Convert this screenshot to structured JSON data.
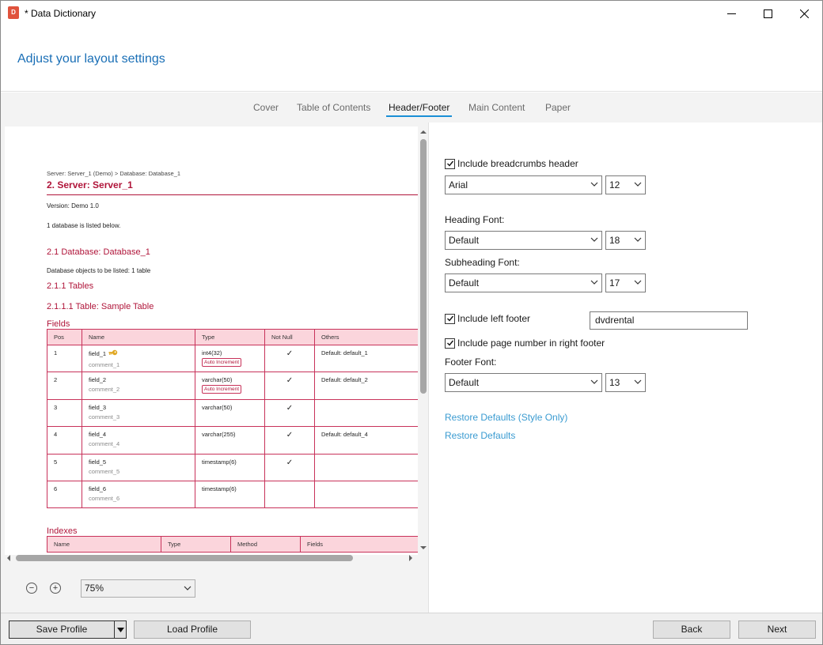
{
  "window": {
    "title": "* Data Dictionary",
    "icon_label": "D"
  },
  "header": {
    "title": "Adjust your layout settings"
  },
  "tabs": [
    {
      "label": "Cover",
      "active": false
    },
    {
      "label": "Table of Contents",
      "active": false
    },
    {
      "label": "Header/Footer",
      "active": true
    },
    {
      "label": "Main Content",
      "active": false
    },
    {
      "label": "Paper",
      "active": false
    }
  ],
  "preview": {
    "breadcrumb": "Server: Server_1 (Demo)  >  Database: Database_1",
    "server_title": "2. Server: Server_1",
    "version": "Version: Demo 1.0",
    "db_listed": "1 database is listed below.",
    "db_title": "2.1 Database: Database_1",
    "db_objects": "Database objects to be listed: 1 table",
    "tables_title": "2.1.1 Tables",
    "table_title": "2.1.1.1 Table: Sample Table",
    "fields_title": "Fields",
    "fields_headers": [
      "Pos",
      "Name",
      "Type",
      "Not Null",
      "Others"
    ],
    "fields_rows": [
      {
        "pos": "1",
        "name": "field_1",
        "comment": "comment_1",
        "type": "int4(32)",
        "badge": "Auto Increment",
        "not_null": "✓",
        "others": "Default: default_1",
        "key": true
      },
      {
        "pos": "2",
        "name": "field_2",
        "comment": "comment_2",
        "type": "varchar(50)",
        "badge": "Auto Increment",
        "not_null": "✓",
        "others": "Default: default_2",
        "key": false
      },
      {
        "pos": "3",
        "name": "field_3",
        "comment": "comment_3",
        "type": "varchar(50)",
        "badge": "",
        "not_null": "✓",
        "others": "",
        "key": false
      },
      {
        "pos": "4",
        "name": "field_4",
        "comment": "comment_4",
        "type": "varchar(255)",
        "badge": "",
        "not_null": "✓",
        "others": "Default: default_4",
        "key": false
      },
      {
        "pos": "5",
        "name": "field_5",
        "comment": "comment_5",
        "type": "timestamp(6)",
        "badge": "",
        "not_null": "✓",
        "others": "",
        "key": false
      },
      {
        "pos": "6",
        "name": "field_6",
        "comment": "comment_6",
        "type": "timestamp(6)",
        "badge": "",
        "not_null": "",
        "others": "",
        "key": false
      }
    ],
    "indexes_title": "Indexes",
    "indexes_headers": [
      "Name",
      "Type",
      "Method",
      "Fields"
    ]
  },
  "zoom": {
    "value": "75%"
  },
  "settings": {
    "breadcrumbs_checkbox_label": "Include breadcrumbs header",
    "breadcrumbs_checked": true,
    "breadcrumbs_font": "Arial",
    "breadcrumbs_size": "12",
    "heading_font_label": "Heading Font:",
    "heading_font": "Default",
    "heading_size": "18",
    "subheading_font_label": "Subheading Font:",
    "subheading_font": "Default",
    "subheading_size": "17",
    "left_footer_label": "Include left footer",
    "left_footer_checked": true,
    "left_footer_value": "dvdrental",
    "page_number_label": "Include page number in right footer",
    "page_number_checked": true,
    "footer_font_label": "Footer Font:",
    "footer_font": "Default",
    "footer_size": "13",
    "restore_style_link": "Restore Defaults (Style Only)",
    "restore_link": "Restore Defaults"
  },
  "buttons": {
    "save_profile": "Save Profile",
    "load_profile": "Load Profile",
    "back": "Back",
    "next": "Next"
  },
  "colors": {
    "accent": "#1a6fb6",
    "link": "#3a9bd1",
    "doc_heading": "#b0153a",
    "table_header_bg": "#fbd5dc",
    "table_border": "#c8325a"
  }
}
